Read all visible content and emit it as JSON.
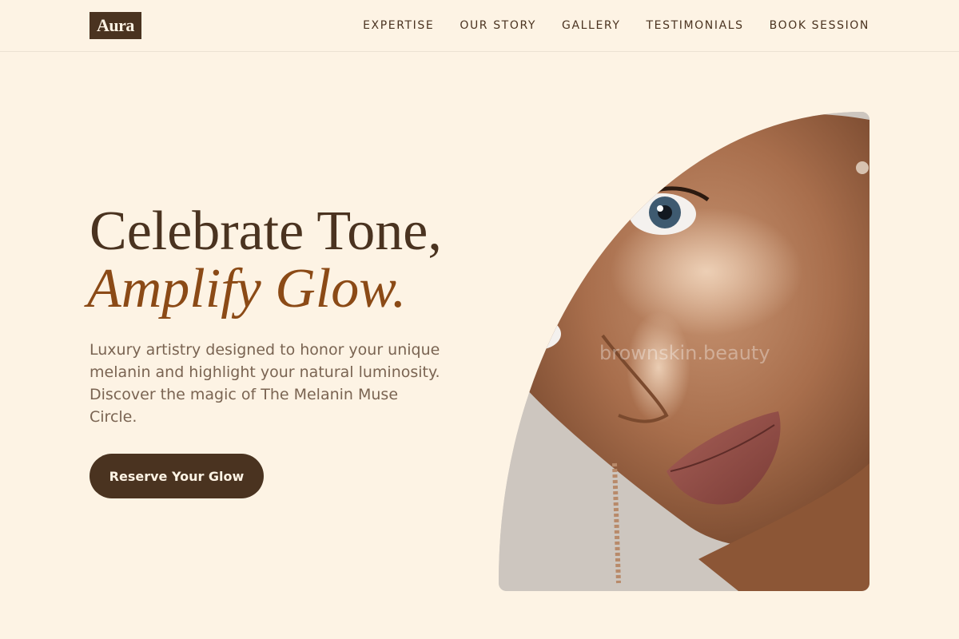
{
  "header": {
    "logo": "Aura",
    "nav": [
      "EXPERTISE",
      "OUR STORY",
      "GALLERY",
      "TESTIMONIALS",
      "BOOK SESSION"
    ]
  },
  "hero": {
    "title_line1": "Celebrate Tone,",
    "title_line2": "Amplify Glow.",
    "description": "Luxury artistry designed to honor your unique melanin and highlight your natural luminosity. Discover the magic of The Melanin Muse Circle.",
    "cta_label": "Reserve Your Glow"
  },
  "image": {
    "watermark": "brownskin.beauty"
  },
  "colors": {
    "background": "#fdf3e4",
    "primary": "#4a3320",
    "accent": "#8b4a16",
    "body_text": "#7a6452"
  }
}
